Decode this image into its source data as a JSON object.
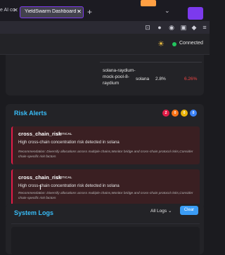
{
  "browser": {
    "prev_tab_title": "e AI co",
    "active_tab_title": "YieldSwarm Dashboard - Adva",
    "new_tab_icon": "plus-icon",
    "tab_list_icon": "chevron-down-icon"
  },
  "header": {
    "theme_icon": "sun-icon",
    "connection_status": "Connected",
    "connection_color": "#22c55e"
  },
  "table": {
    "row": {
      "name": "solana-raydium-mock-pool-8-raydium",
      "network": "solana",
      "apy": "2.8%",
      "change": "6.26%"
    },
    "change_color": "#ef4444"
  },
  "risk_alerts": {
    "title": "Risk Alerts",
    "badges": [
      {
        "label": "2",
        "color": "#e11d48"
      },
      {
        "label": "0",
        "color": "#f97316"
      },
      {
        "label": "0",
        "color": "#eab308"
      },
      {
        "label": "0",
        "color": "#3b82f6"
      }
    ],
    "items": [
      {
        "type": "cross_chain_risk",
        "severity": "CRITICAL",
        "message": "High cross-chain concentration risk detected in solana",
        "recommendation": "Recommendation: Diversify allocations across multiple chains,Monitor bridge and cross-chain protocol risks,Consider chain-specific risk factors"
      },
      {
        "type": "cross_chain_risk",
        "severity": "CRITICAL",
        "message": "High cross-chain concentration risk detected in solana",
        "recommendation": "Recommendation: Diversify allocations across multiple chains,Monitor bridge and cross-chain protocol risks,Consider chain-specific risk factors"
      }
    ]
  },
  "system_logs": {
    "title": "System Logs",
    "filter_value": "All Logs",
    "clear_label": "Clear"
  },
  "colors": {
    "accent": "#38bdf8",
    "critical": "#e11d48",
    "clear_button": "#3b9cf5"
  }
}
